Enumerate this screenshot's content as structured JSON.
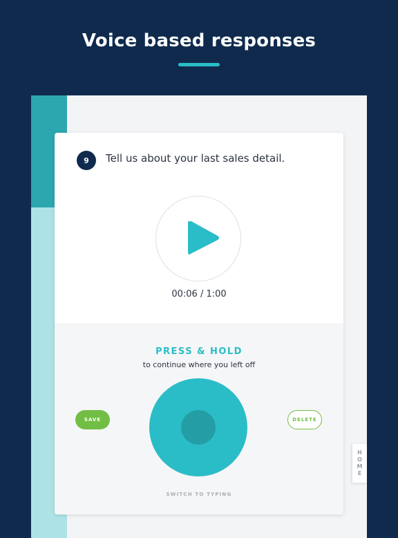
{
  "header": {
    "title": "Voice based responses",
    "accent_color": "#2bbdc7",
    "background_color": "#0f2a4d"
  },
  "question": {
    "number": "9",
    "text": "Tell us about your last sales detail."
  },
  "player": {
    "icon": "play-icon",
    "timer": "00:06 / 1:00"
  },
  "recorder": {
    "title": "PRESS & HOLD",
    "hint": "to continue where you left off",
    "save_label": "SAVE",
    "delete_label": "DELETE",
    "switch_label": "SWITCH TO TYPING",
    "button_color": "#2bbdc7",
    "save_color": "#72be44"
  },
  "home_tab": {
    "label": "HOME"
  }
}
